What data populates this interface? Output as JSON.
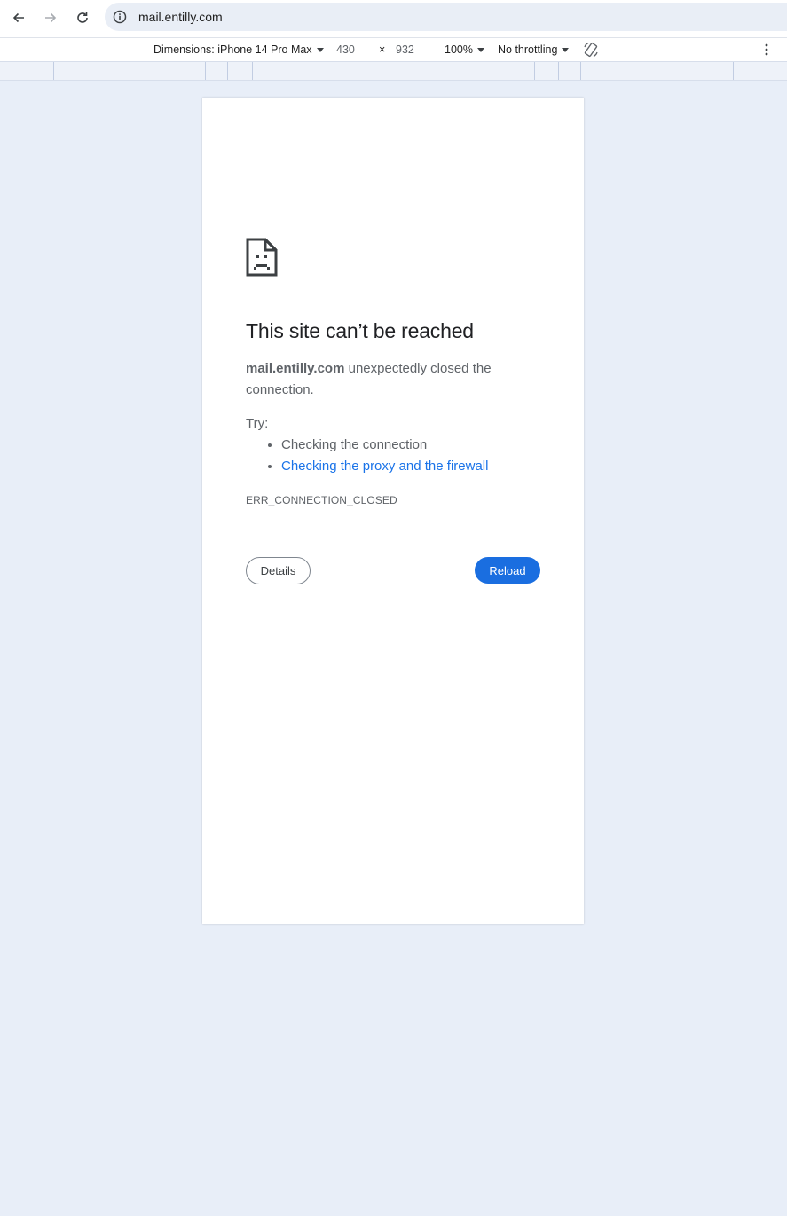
{
  "browser": {
    "url": "mail.entilly.com",
    "nav": {
      "back_icon": "back-arrow-icon",
      "forward_icon": "forward-arrow-icon",
      "reload_icon": "reload-icon"
    }
  },
  "device_toolbar": {
    "dimensions_label": "Dimensions: iPhone 14 Pro Max",
    "width": "430",
    "separator": "×",
    "height": "932",
    "zoom": "100%",
    "throttling": "No throttling"
  },
  "error_page": {
    "title": "This site can’t be reached",
    "host": "mail.entilly.com",
    "message": " unexpectedly closed the connection.",
    "try_label": "Try:",
    "suggestions": [
      {
        "text": "Checking the connection",
        "link": false
      },
      {
        "text": "Checking the proxy and the firewall",
        "link": true
      }
    ],
    "error_code": "ERR_CONNECTION_CLOSED",
    "details_label": "Details",
    "reload_label": "Reload"
  },
  "colors": {
    "accent": "#1a73e8",
    "page_background": "#e8eef8",
    "reload_button": "#1a6ee0"
  }
}
